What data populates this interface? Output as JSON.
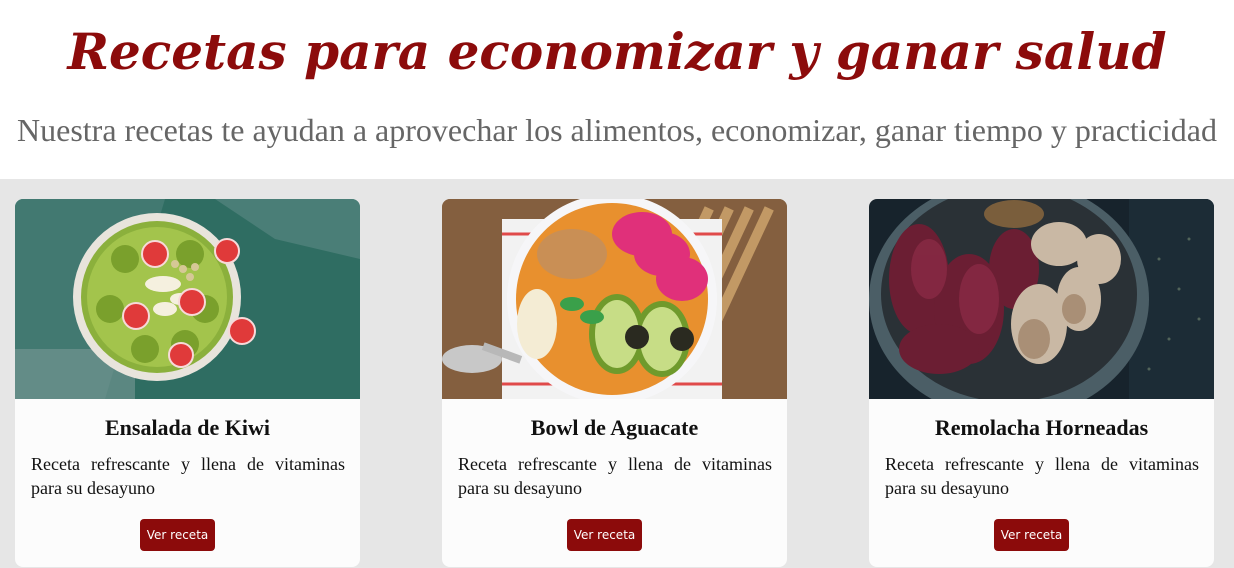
{
  "header": {
    "title": "Recetas para economizar y ganar salud",
    "subtitle": "Nuestra recetas te ayudan a aprovechar los alimentos, economizar, ganar tiempo y practicidad"
  },
  "colors": {
    "accent": "#8c0b0b",
    "subtitle": "#666666",
    "section_bg": "#e6e6e6",
    "card_bg": "#fcfcfc"
  },
  "cards": [
    {
      "title": "Ensalada de Kiwi",
      "description": "Receta refrescante y llena de vitaminas para su desayuno",
      "button_label": "Ver receta",
      "image": "kiwi-strawberry-smoothie-bowl-photo"
    },
    {
      "title": "Bowl de Aguacate",
      "description": "Receta refrescante y llena de vitaminas para su desayuno",
      "button_label": "Ver receta",
      "image": "avocado-dragonfruit-bowl-photo"
    },
    {
      "title": "Remolacha Horneadas",
      "description": "Receta refrescante y llena de vitaminas para su desayuno",
      "button_label": "Ver receta",
      "image": "roasted-beet-garlic-bowl-photo"
    }
  ]
}
